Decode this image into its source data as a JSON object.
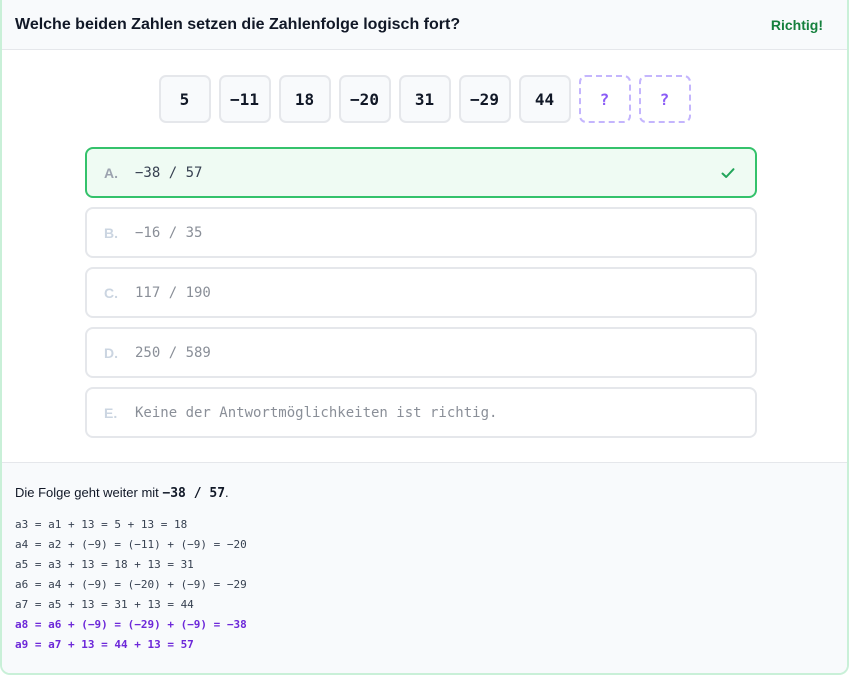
{
  "header": {
    "question": "Welche beiden Zahlen setzen die Zahlenfolge logisch fort?",
    "status": "Richtig!"
  },
  "sequence": {
    "numbers": [
      "5",
      "−11",
      "18",
      "−20",
      "31",
      "−29",
      "44"
    ],
    "unknowns": [
      "?",
      "?"
    ]
  },
  "options": [
    {
      "letter": "A.",
      "text": "−38 / 57",
      "correct": true
    },
    {
      "letter": "B.",
      "text": "−16 / 35"
    },
    {
      "letter": "C.",
      "text": "117 / 190"
    },
    {
      "letter": "D.",
      "text": "250 / 589"
    },
    {
      "letter": "E.",
      "text": "Keine der Antwortmöglichkeiten ist richtig."
    }
  ],
  "explanation": {
    "prefix": "Die Folge geht weiter mit ",
    "answer": "−38 / 57",
    "suffix": ".",
    "steps": [
      "a3 = a1 + 13 = 5 + 13 = 18",
      "a4 = a2 + (−9) = (−11) + (−9) = −20",
      "a5 = a3 + 13 = 18 + 13 = 31",
      "a6 = a4 + (−9) = (−20) + (−9) = −29",
      "a7 = a5 + 13 = 31 + 13 = 44",
      "a8 = a6 + (−9) = (−29) + (−9) = −38",
      "a9 = a7 + 13 = 44 + 13 = 57"
    ]
  },
  "colors": {
    "correct_green": "#34c26b",
    "status_green": "#15803d",
    "highlight_purple": "#6d28d9",
    "unknown_purple": "#c4b5fd"
  },
  "icons": {
    "check": "check-icon"
  }
}
